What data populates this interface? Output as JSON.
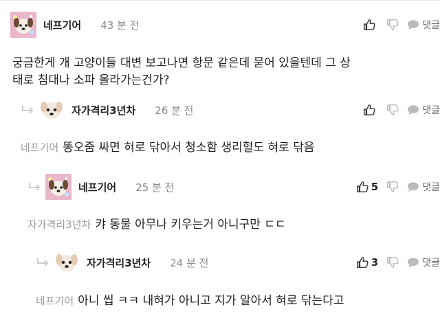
{
  "comments": [
    {
      "nickname": "네프기어",
      "time": "43 분 전",
      "likes": "",
      "mention": "",
      "body_lines": [
        "궁금한게 개 고양이들 대변 보고나면 항문 같은데 묻어 있을텐데 그 상",
        "태로 침대나 소파 올라가는건가?"
      ],
      "reply_label": "댓글",
      "avatar_icon": "pink-sparkle-dog-avatar-icon"
    },
    {
      "nickname": "자가격리3년차",
      "time": "26 분 전",
      "likes": "",
      "mention": "네프기어",
      "body_lines": [
        "똥오줌 싸면 혀로 닦아서 청소함 생리혈도 혀로 닦음"
      ],
      "reply_label": "댓글",
      "avatar_icon": "white-puppy-avatar-icon"
    },
    {
      "nickname": "네프기어",
      "time": "25 분 전",
      "likes": "5",
      "mention": "자가격리3년차",
      "body_lines": [
        "캬 동물 아무나 키우는거 아니구만 ㄷㄷ"
      ],
      "reply_label": "댓글",
      "avatar_icon": "pink-sparkle-dog-avatar-icon"
    },
    {
      "nickname": "자가격리3년차",
      "time": "24 분 전",
      "likes": "3",
      "mention": "네프기어",
      "body_lines": [
        "아니 씹 ㅋㅋ 내혀가 아니고 지가 알아서 혀로 닦는다고"
      ],
      "reply_label": "댓글",
      "avatar_icon": "white-puppy-avatar-icon"
    }
  ],
  "colors": {
    "text": "#222222",
    "muted": "#8a8a8a",
    "icon": "#333333",
    "icon_light": "#bbbbbb"
  }
}
